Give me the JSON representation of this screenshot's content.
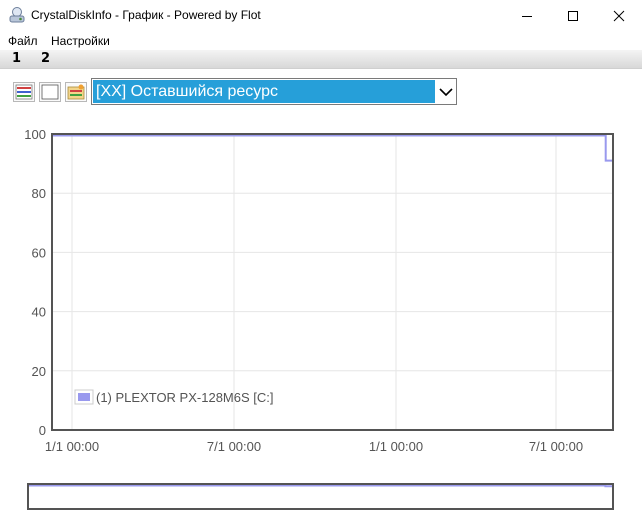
{
  "window": {
    "title": "CrystalDiskInfo - График - Powered by Flot"
  },
  "menu": {
    "items": [
      "Файл",
      "Настройки"
    ]
  },
  "tabs": [
    "1",
    "2"
  ],
  "toolbar": {
    "selected_attribute": "[XX] Оставшийся ресурс"
  },
  "colors": {
    "accent": "#269fd9",
    "series": "#9999ee",
    "axis": "#545454",
    "grid": "#e6e6e6"
  },
  "chart_data": {
    "type": "line",
    "x_tick_labels": [
      "1/1 00:00",
      "7/1 00:00",
      "1/1 00:00",
      "7/1 00:00"
    ],
    "ylim": [
      0,
      100
    ],
    "y_ticks": [
      0,
      20,
      40,
      60,
      80,
      100
    ],
    "grid": true,
    "legend_position": "bottom-left",
    "series": [
      {
        "name": "(1) PLEXTOR PX-128M6S [C:]",
        "points": [
          {
            "t": 0.0,
            "y": 100
          },
          {
            "t": 0.987,
            "y": 100
          },
          {
            "t": 0.987,
            "y": 91
          },
          {
            "t": 1.0,
            "y": 91
          }
        ]
      }
    ]
  }
}
